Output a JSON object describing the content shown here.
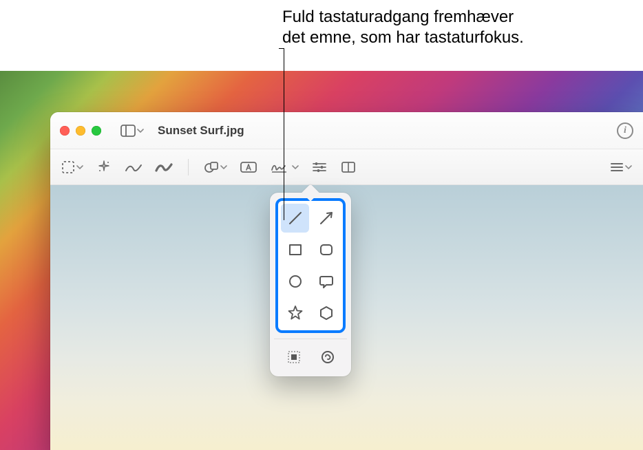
{
  "callout": {
    "line1": "Fuld tastaturadgang fremhæver",
    "line2": "det emne, som har tastaturfokus."
  },
  "window": {
    "title": "Sunset Surf.jpg",
    "traffic": {
      "close": "close",
      "minimize": "minimize",
      "zoom": "zoom"
    },
    "sidebar_button": "toggle-sidebar",
    "info_button": "i"
  },
  "toolbar": {
    "selection": "rectangular-selection",
    "instant_alpha": "instant-alpha",
    "sketch": "sketch",
    "draw": "draw",
    "shapes": "shapes",
    "text": "text",
    "sign": "sign",
    "adjust": "adjust-color",
    "crop": "crop",
    "more": "more"
  },
  "shapes_popover": {
    "line": "line",
    "arrow": "arrow",
    "rectangle": "rectangle",
    "rounded_rectangle": "rounded-rectangle",
    "ellipse": "ellipse",
    "speech_bubble": "speech-bubble",
    "star": "star",
    "polygon": "polygon",
    "loupe": "loupe",
    "mask": "mask",
    "selected_index": 0,
    "focus": true
  },
  "colors": {
    "focus_ring": "#0a7bff",
    "selected_bg": "#cfe3fb",
    "icon": "#585858"
  }
}
